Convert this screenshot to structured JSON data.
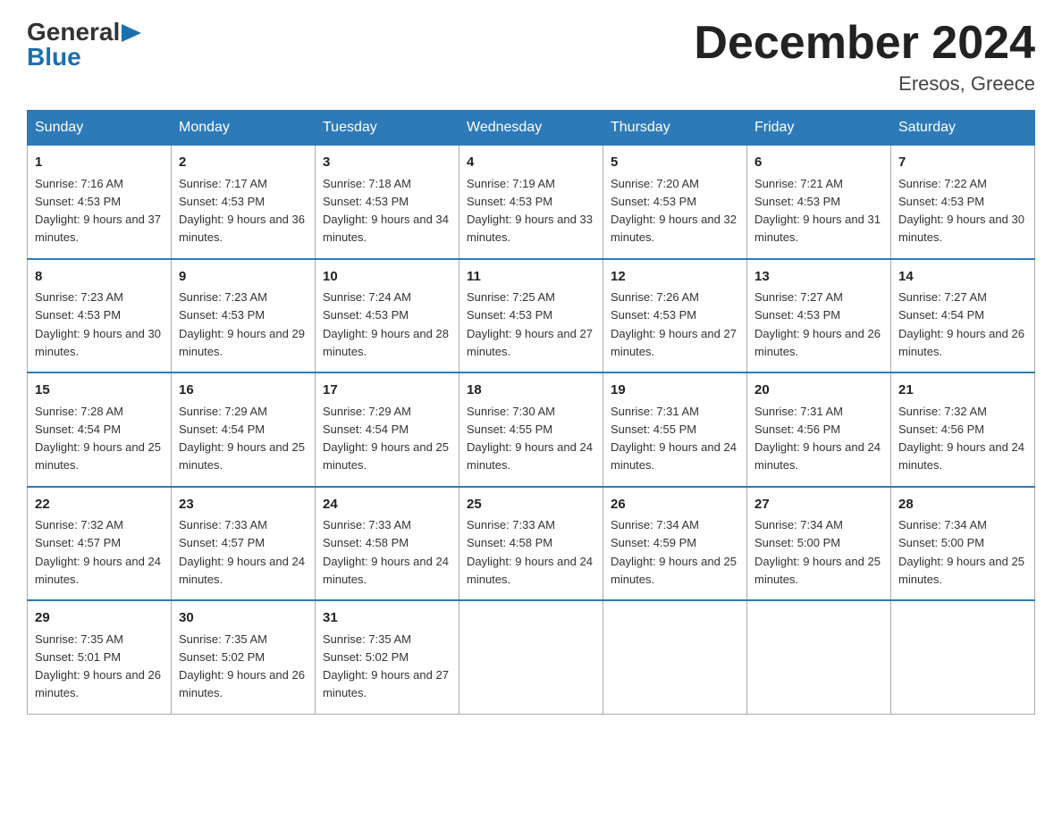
{
  "logo": {
    "part1": "General",
    "arrow": "▶",
    "part2": "Blue"
  },
  "header": {
    "title": "December 2024",
    "location": "Eresos, Greece"
  },
  "days_of_week": [
    "Sunday",
    "Monday",
    "Tuesday",
    "Wednesday",
    "Thursday",
    "Friday",
    "Saturday"
  ],
  "weeks": [
    [
      {
        "day": "1",
        "sunrise": "7:16 AM",
        "sunset": "4:53 PM",
        "daylight": "9 hours and 37 minutes."
      },
      {
        "day": "2",
        "sunrise": "7:17 AM",
        "sunset": "4:53 PM",
        "daylight": "9 hours and 36 minutes."
      },
      {
        "day": "3",
        "sunrise": "7:18 AM",
        "sunset": "4:53 PM",
        "daylight": "9 hours and 34 minutes."
      },
      {
        "day": "4",
        "sunrise": "7:19 AM",
        "sunset": "4:53 PM",
        "daylight": "9 hours and 33 minutes."
      },
      {
        "day": "5",
        "sunrise": "7:20 AM",
        "sunset": "4:53 PM",
        "daylight": "9 hours and 32 minutes."
      },
      {
        "day": "6",
        "sunrise": "7:21 AM",
        "sunset": "4:53 PM",
        "daylight": "9 hours and 31 minutes."
      },
      {
        "day": "7",
        "sunrise": "7:22 AM",
        "sunset": "4:53 PM",
        "daylight": "9 hours and 30 minutes."
      }
    ],
    [
      {
        "day": "8",
        "sunrise": "7:23 AM",
        "sunset": "4:53 PM",
        "daylight": "9 hours and 30 minutes."
      },
      {
        "day": "9",
        "sunrise": "7:23 AM",
        "sunset": "4:53 PM",
        "daylight": "9 hours and 29 minutes."
      },
      {
        "day": "10",
        "sunrise": "7:24 AM",
        "sunset": "4:53 PM",
        "daylight": "9 hours and 28 minutes."
      },
      {
        "day": "11",
        "sunrise": "7:25 AM",
        "sunset": "4:53 PM",
        "daylight": "9 hours and 27 minutes."
      },
      {
        "day": "12",
        "sunrise": "7:26 AM",
        "sunset": "4:53 PM",
        "daylight": "9 hours and 27 minutes."
      },
      {
        "day": "13",
        "sunrise": "7:27 AM",
        "sunset": "4:53 PM",
        "daylight": "9 hours and 26 minutes."
      },
      {
        "day": "14",
        "sunrise": "7:27 AM",
        "sunset": "4:54 PM",
        "daylight": "9 hours and 26 minutes."
      }
    ],
    [
      {
        "day": "15",
        "sunrise": "7:28 AM",
        "sunset": "4:54 PM",
        "daylight": "9 hours and 25 minutes."
      },
      {
        "day": "16",
        "sunrise": "7:29 AM",
        "sunset": "4:54 PM",
        "daylight": "9 hours and 25 minutes."
      },
      {
        "day": "17",
        "sunrise": "7:29 AM",
        "sunset": "4:54 PM",
        "daylight": "9 hours and 25 minutes."
      },
      {
        "day": "18",
        "sunrise": "7:30 AM",
        "sunset": "4:55 PM",
        "daylight": "9 hours and 24 minutes."
      },
      {
        "day": "19",
        "sunrise": "7:31 AM",
        "sunset": "4:55 PM",
        "daylight": "9 hours and 24 minutes."
      },
      {
        "day": "20",
        "sunrise": "7:31 AM",
        "sunset": "4:56 PM",
        "daylight": "9 hours and 24 minutes."
      },
      {
        "day": "21",
        "sunrise": "7:32 AM",
        "sunset": "4:56 PM",
        "daylight": "9 hours and 24 minutes."
      }
    ],
    [
      {
        "day": "22",
        "sunrise": "7:32 AM",
        "sunset": "4:57 PM",
        "daylight": "9 hours and 24 minutes."
      },
      {
        "day": "23",
        "sunrise": "7:33 AM",
        "sunset": "4:57 PM",
        "daylight": "9 hours and 24 minutes."
      },
      {
        "day": "24",
        "sunrise": "7:33 AM",
        "sunset": "4:58 PM",
        "daylight": "9 hours and 24 minutes."
      },
      {
        "day": "25",
        "sunrise": "7:33 AM",
        "sunset": "4:58 PM",
        "daylight": "9 hours and 24 minutes."
      },
      {
        "day": "26",
        "sunrise": "7:34 AM",
        "sunset": "4:59 PM",
        "daylight": "9 hours and 25 minutes."
      },
      {
        "day": "27",
        "sunrise": "7:34 AM",
        "sunset": "5:00 PM",
        "daylight": "9 hours and 25 minutes."
      },
      {
        "day": "28",
        "sunrise": "7:34 AM",
        "sunset": "5:00 PM",
        "daylight": "9 hours and 25 minutes."
      }
    ],
    [
      {
        "day": "29",
        "sunrise": "7:35 AM",
        "sunset": "5:01 PM",
        "daylight": "9 hours and 26 minutes."
      },
      {
        "day": "30",
        "sunrise": "7:35 AM",
        "sunset": "5:02 PM",
        "daylight": "9 hours and 26 minutes."
      },
      {
        "day": "31",
        "sunrise": "7:35 AM",
        "sunset": "5:02 PM",
        "daylight": "9 hours and 27 minutes."
      },
      null,
      null,
      null,
      null
    ]
  ],
  "labels": {
    "sunrise_prefix": "Sunrise: ",
    "sunset_prefix": "Sunset: ",
    "daylight_prefix": "Daylight: "
  }
}
